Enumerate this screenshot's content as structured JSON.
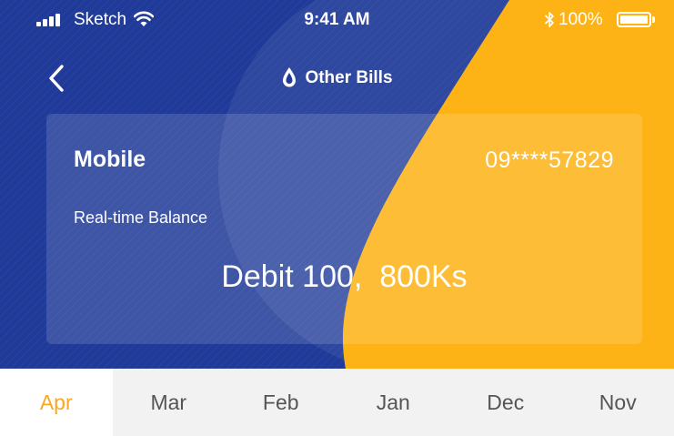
{
  "status_bar": {
    "carrier": "Sketch",
    "time": "9:41 AM",
    "battery": "100%"
  },
  "nav": {
    "title": "Other Bills",
    "back_icon": "chevron-left-icon",
    "logo_icon": "drop-logo-icon"
  },
  "card": {
    "type": "Mobile",
    "number": "09****57829",
    "label": "Real-time Balance",
    "amount": "Debit 100,  800Ks"
  },
  "tabs": [
    {
      "label": "Apr",
      "active": true
    },
    {
      "label": "Mar",
      "active": false
    },
    {
      "label": "Feb",
      "active": false
    },
    {
      "label": "Jan",
      "active": false
    },
    {
      "label": "Dec",
      "active": false
    },
    {
      "label": "Nov",
      "active": false
    }
  ],
  "colors": {
    "primary_blue": "#1f3a98",
    "accent_orange": "#fdb316",
    "active_tab_text": "#f7a826"
  }
}
